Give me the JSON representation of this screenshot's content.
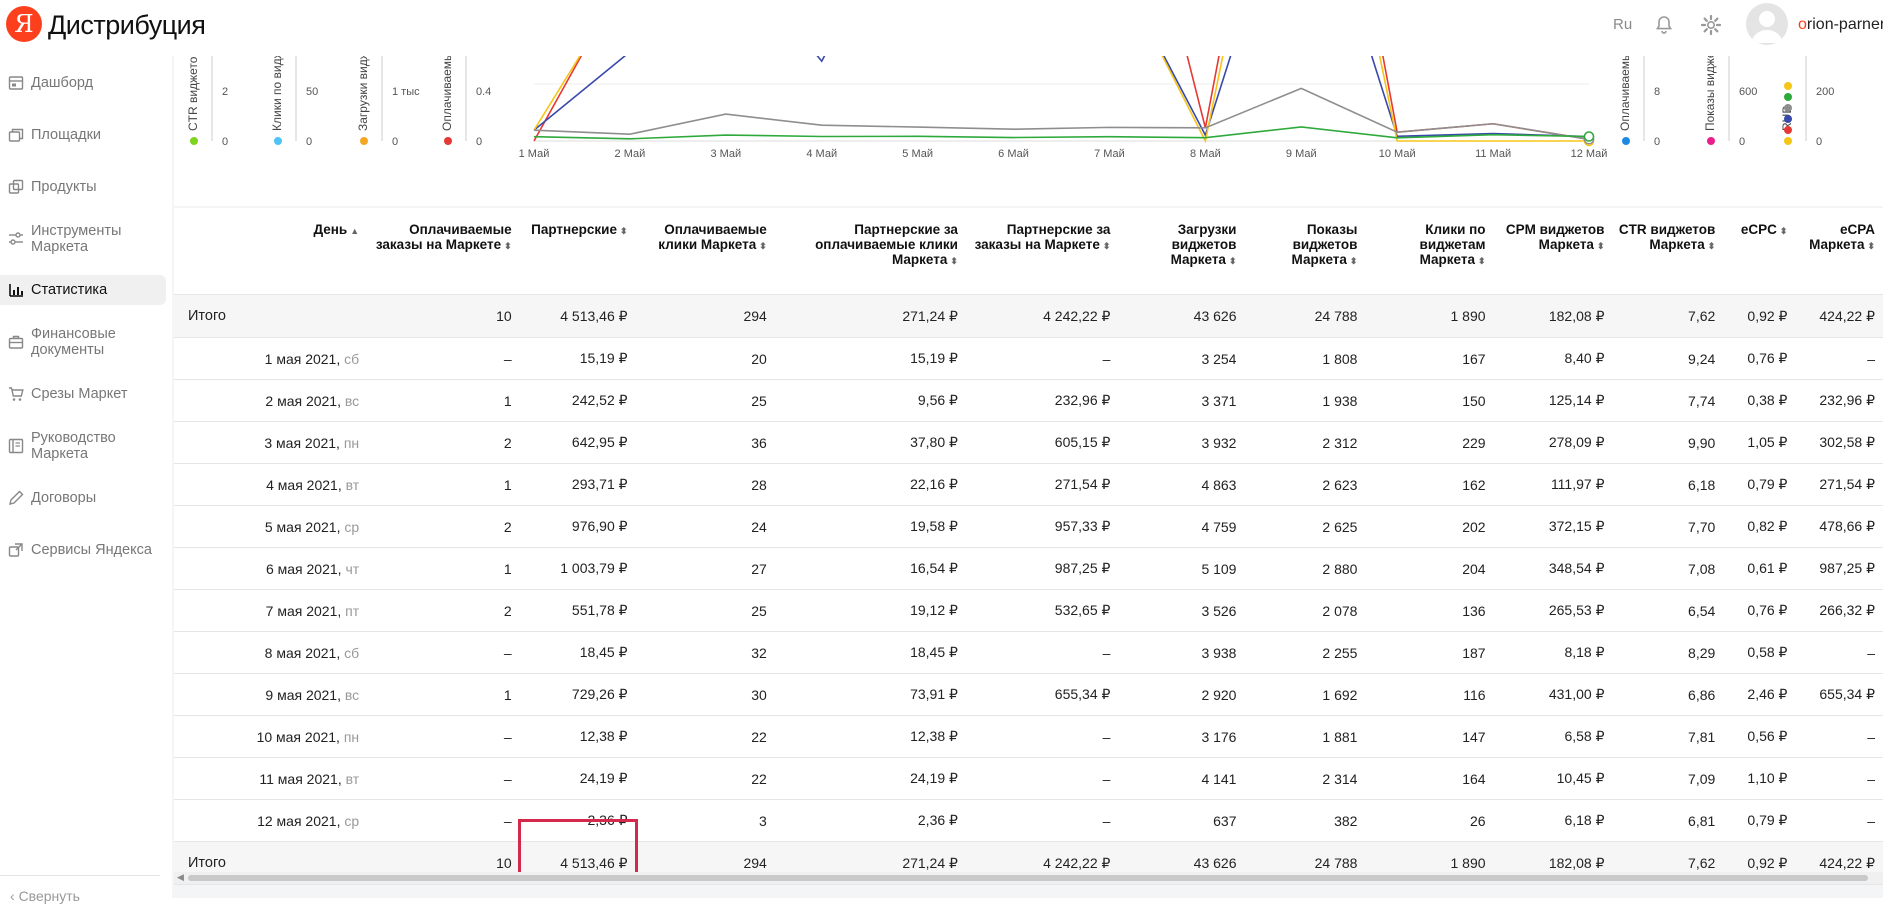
{
  "header": {
    "logo_letter": "Я",
    "app_title": "Дистрибуция",
    "lang": "Ru",
    "username_first": "o",
    "username_rest": "rion-parners"
  },
  "sidebar": {
    "items": [
      {
        "label": "Дашборд",
        "icon": "dashboard-icon"
      },
      {
        "label": "Площадки",
        "icon": "platforms-icon"
      },
      {
        "label": "Продукты",
        "icon": "products-icon"
      },
      {
        "label": "Инструменты Маркета",
        "icon": "tools-icon"
      },
      {
        "label": "Статистика",
        "icon": "chart-bar-icon",
        "active": true
      },
      {
        "label": "Финансовые документы",
        "icon": "briefcase-icon"
      },
      {
        "label": "Срезы Маркет",
        "icon": "cart-icon"
      },
      {
        "label": "Руководство Маркета",
        "icon": "book-icon"
      },
      {
        "label": "Договоры",
        "icon": "pen-icon"
      },
      {
        "label": "Сервисы Яндекса",
        "icon": "services-icon"
      }
    ],
    "collapse_label": "Свернуть"
  },
  "chart": {
    "left_axes": [
      {
        "label": "CTR виджетов Ма",
        "ticks": [
          "2",
          "0"
        ],
        "dot_color": "#7ed321"
      },
      {
        "label": "Клики по виджет",
        "ticks": [
          "50",
          "0"
        ],
        "dot_color": "#4fc3f7"
      },
      {
        "label": "Загрузки виджет",
        "ticks": [
          "1 тыс",
          "0"
        ],
        "dot_color": "#f5a623"
      },
      {
        "label": "Оплачиваемые за",
        "ticks": [
          "0.4",
          "0"
        ],
        "dot_color": "#e53935"
      }
    ],
    "right_axes": [
      {
        "label": "Оплачиваемые кл",
        "ticks": [
          "8",
          "0"
        ],
        "dot_color": "#1e88e5"
      },
      {
        "label": "Показы виджетов",
        "ticks": [
          "600",
          "0"
        ],
        "dot_color": "#e91e8c"
      },
      {
        "label": "RUB",
        "ticks": [
          "200",
          "0"
        ],
        "dot_colors": [
          "#f5c518",
          "#e53935",
          "#3949ab",
          "#8e8e8e",
          "#2eaa3c",
          "#f5c518"
        ]
      }
    ],
    "x_labels": [
      "1 Май",
      "2 Май",
      "3 Май",
      "4 Май",
      "5 Май",
      "6 Май",
      "7 Май",
      "8 Май",
      "9 Май",
      "10 Май",
      "11 Май",
      "12 Май"
    ]
  },
  "chart_data": {
    "type": "line",
    "x": [
      "1 Май",
      "2 Май",
      "3 Май",
      "4 Май",
      "5 Май",
      "6 Май",
      "7 Май",
      "8 Май",
      "9 Май",
      "10 Май",
      "11 Май",
      "12 Май"
    ],
    "series": [
      {
        "color": "#e53935",
        "values": [
          0,
          242.52,
          642.95,
          293.71,
          976.9,
          1003.79,
          551.78,
          18.45,
          729.26,
          12.38,
          24.19,
          2.36
        ]
      },
      {
        "color": "#3949ab",
        "values": [
          15.19,
          125.14,
          278.09,
          111.97,
          372.15,
          348.54,
          265.53,
          8.18,
          431.0,
          6.58,
          10.45,
          6.18
        ]
      },
      {
        "color": "#f5c518",
        "values": [
          15.19,
          232.96,
          302.58,
          271.54,
          478.66,
          987.25,
          266.32,
          0,
          655.34,
          0,
          0,
          0
        ]
      },
      {
        "color": "#8e8e8e",
        "values": [
          15.19,
          9.56,
          37.8,
          22.16,
          19.58,
          16.54,
          19.12,
          18.45,
          73.91,
          12.38,
          24.19,
          2.36
        ]
      },
      {
        "color": "#2eaa3c",
        "values": [
          0.76,
          0.38,
          1.05,
          0.79,
          0.82,
          0.61,
          0.76,
          0.58,
          2.46,
          0.56,
          1.1,
          0.79
        ]
      }
    ]
  },
  "table": {
    "columns": [
      {
        "label": "День",
        "sort": "▲"
      },
      {
        "label": "Оплачиваемые заказы на Маркете",
        "sort": "⬍"
      },
      {
        "label": "Партнерские",
        "sort": "⬍"
      },
      {
        "label": "Оплачиваемые клики Маркета",
        "sort": "⬍"
      },
      {
        "label": "Партнерские за оплачиваемые клики Маркета",
        "sort": "⬍"
      },
      {
        "label": "Партнерские за заказы на Маркете",
        "sort": "⬍"
      },
      {
        "label": "Загрузки виджетов Маркета",
        "sort": "⬍"
      },
      {
        "label": "Показы виджетов Маркета",
        "sort": "⬍"
      },
      {
        "label": "Клики по виджетам Маркета",
        "sort": "⬍"
      },
      {
        "label": "CPM виджетов Маркета",
        "sort": "⬍"
      },
      {
        "label": "CTR виджетов Маркета",
        "sort": "⬍"
      },
      {
        "label": "eCPC",
        "sort": "⬍"
      },
      {
        "label": "eCPA Маркета",
        "sort": "⬍"
      }
    ],
    "total_top": [
      "Итого",
      "10",
      "4 513,46 ₽",
      "294",
      "271,24 ₽",
      "4 242,22 ₽",
      "43 626",
      "24 788",
      "1 890",
      "182,08 ₽",
      "7,62",
      "0,92 ₽",
      "424,22 ₽"
    ],
    "rows": [
      {
        "date": "1 мая 2021,",
        "wd": "сб",
        "cells": [
          "–",
          "15,19 ₽",
          "20",
          "15,19 ₽",
          "–",
          "3 254",
          "1 808",
          "167",
          "8,40 ₽",
          "9,24",
          "0,76 ₽",
          "–"
        ]
      },
      {
        "date": "2 мая 2021,",
        "wd": "вс",
        "cells": [
          "1",
          "242,52 ₽",
          "25",
          "9,56 ₽",
          "232,96 ₽",
          "3 371",
          "1 938",
          "150",
          "125,14 ₽",
          "7,74",
          "0,38 ₽",
          "232,96 ₽"
        ]
      },
      {
        "date": "3 мая 2021,",
        "wd": "пн",
        "cells": [
          "2",
          "642,95 ₽",
          "36",
          "37,80 ₽",
          "605,15 ₽",
          "3 932",
          "2 312",
          "229",
          "278,09 ₽",
          "9,90",
          "1,05 ₽",
          "302,58 ₽"
        ]
      },
      {
        "date": "4 мая 2021,",
        "wd": "вт",
        "cells": [
          "1",
          "293,71 ₽",
          "28",
          "22,16 ₽",
          "271,54 ₽",
          "4 863",
          "2 623",
          "162",
          "111,97 ₽",
          "6,18",
          "0,79 ₽",
          "271,54 ₽"
        ]
      },
      {
        "date": "5 мая 2021,",
        "wd": "ср",
        "cells": [
          "2",
          "976,90 ₽",
          "24",
          "19,58 ₽",
          "957,33 ₽",
          "4 759",
          "2 625",
          "202",
          "372,15 ₽",
          "7,70",
          "0,82 ₽",
          "478,66 ₽"
        ]
      },
      {
        "date": "6 мая 2021,",
        "wd": "чт",
        "cells": [
          "1",
          "1 003,79 ₽",
          "27",
          "16,54 ₽",
          "987,25 ₽",
          "5 109",
          "2 880",
          "204",
          "348,54 ₽",
          "7,08",
          "0,61 ₽",
          "987,25 ₽"
        ]
      },
      {
        "date": "7 мая 2021,",
        "wd": "пт",
        "cells": [
          "2",
          "551,78 ₽",
          "25",
          "19,12 ₽",
          "532,65 ₽",
          "3 526",
          "2 078",
          "136",
          "265,53 ₽",
          "6,54",
          "0,76 ₽",
          "266,32 ₽"
        ]
      },
      {
        "date": "8 мая 2021,",
        "wd": "сб",
        "cells": [
          "–",
          "18,45 ₽",
          "32",
          "18,45 ₽",
          "–",
          "3 938",
          "2 255",
          "187",
          "8,18 ₽",
          "8,29",
          "0,58 ₽",
          "–"
        ]
      },
      {
        "date": "9 мая 2021,",
        "wd": "вс",
        "cells": [
          "1",
          "729,26 ₽",
          "30",
          "73,91 ₽",
          "655,34 ₽",
          "2 920",
          "1 692",
          "116",
          "431,00 ₽",
          "6,86",
          "2,46 ₽",
          "655,34 ₽"
        ]
      },
      {
        "date": "10 мая 2021,",
        "wd": "пн",
        "cells": [
          "–",
          "12,38 ₽",
          "22",
          "12,38 ₽",
          "–",
          "3 176",
          "1 881",
          "147",
          "6,58 ₽",
          "7,81",
          "0,56 ₽",
          "–"
        ]
      },
      {
        "date": "11 мая 2021,",
        "wd": "вт",
        "cells": [
          "–",
          "24,19 ₽",
          "22",
          "24,19 ₽",
          "–",
          "4 141",
          "2 314",
          "164",
          "10,45 ₽",
          "7,09",
          "1,10 ₽",
          "–"
        ]
      },
      {
        "date": "12 мая 2021,",
        "wd": "ср",
        "cells": [
          "–",
          "2,36 ₽",
          "3",
          "2,36 ₽",
          "–",
          "637",
          "382",
          "26",
          "6,18 ₽",
          "6,81",
          "0,79 ₽",
          "–"
        ]
      }
    ],
    "total_bottom": [
      "Итого",
      "10",
      "4 513,46 ₽",
      "294",
      "271,24 ₽",
      "4 242,22 ₽",
      "43 626",
      "24 788",
      "1 890",
      "182,08 ₽",
      "7,62",
      "0,92 ₽",
      "424,22 ₽"
    ]
  }
}
